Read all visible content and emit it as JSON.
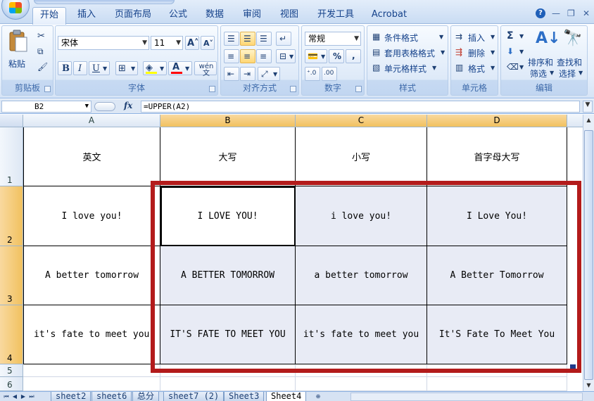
{
  "ribbon_tabs": [
    {
      "label": "开始",
      "active": true
    },
    {
      "label": "插入"
    },
    {
      "label": "页面布局"
    },
    {
      "label": "公式"
    },
    {
      "label": "数据"
    },
    {
      "label": "审阅"
    },
    {
      "label": "视图"
    },
    {
      "label": "开发工具"
    },
    {
      "label": "Acrobat"
    }
  ],
  "clipboard": {
    "paste_label": "粘贴",
    "group_label": "剪贴板"
  },
  "font": {
    "name": "宋体",
    "size": "11",
    "group_label": "字体",
    "bold": "B",
    "italic": "I",
    "underline": "U",
    "phonetic": "wén 文"
  },
  "alignment": {
    "group_label": "对齐方式"
  },
  "number": {
    "format": "常规",
    "group_label": "数字",
    "percent": "%",
    "comma": ","
  },
  "styles": {
    "conditional": "条件格式",
    "table": "套用表格格式",
    "cell": "单元格样式",
    "group_label": "样式"
  },
  "cells": {
    "insert": "插入",
    "delete": "删除",
    "format": "格式",
    "group_label": "单元格"
  },
  "editing": {
    "sigma": "Σ",
    "sort_line1": "排序和",
    "sort_line2": "筛选",
    "find_line1": "查找和",
    "find_line2": "选择",
    "group_label": "编辑"
  },
  "formula_bar": {
    "name_box": "B2",
    "fx": "fx",
    "formula": "=UPPER(A2)"
  },
  "columns": [
    "A",
    "B",
    "C",
    "D"
  ],
  "rows": [
    "1",
    "2",
    "3",
    "4",
    "5",
    "6"
  ],
  "table": {
    "headers": [
      "英文",
      "大写",
      "小写",
      "首字母大写"
    ],
    "rows": [
      [
        "I love you!",
        "I LOVE YOU!",
        "i love you!",
        "I Love You!"
      ],
      [
        "A better tomorrow",
        "A BETTER TOMORROW",
        "a better tomorrow",
        "A Better Tomorrow"
      ],
      [
        "it's fate to meet you",
        "IT'S FATE TO MEET YOU",
        "it's fate to meet you",
        "It'S Fate To Meet You"
      ]
    ]
  },
  "sheet_tabs": [
    {
      "label": "sheet2"
    },
    {
      "label": "sheet6"
    },
    {
      "label": "总分"
    },
    {
      "label": "sheet7 (2)"
    },
    {
      "label": "Sheet3"
    },
    {
      "label": "Sheet4",
      "active": true
    }
  ],
  "colors": {
    "highlight_border": "#b31b1b",
    "selection_fill": "#e8ebf5",
    "header_selected": "#f1c15f"
  }
}
